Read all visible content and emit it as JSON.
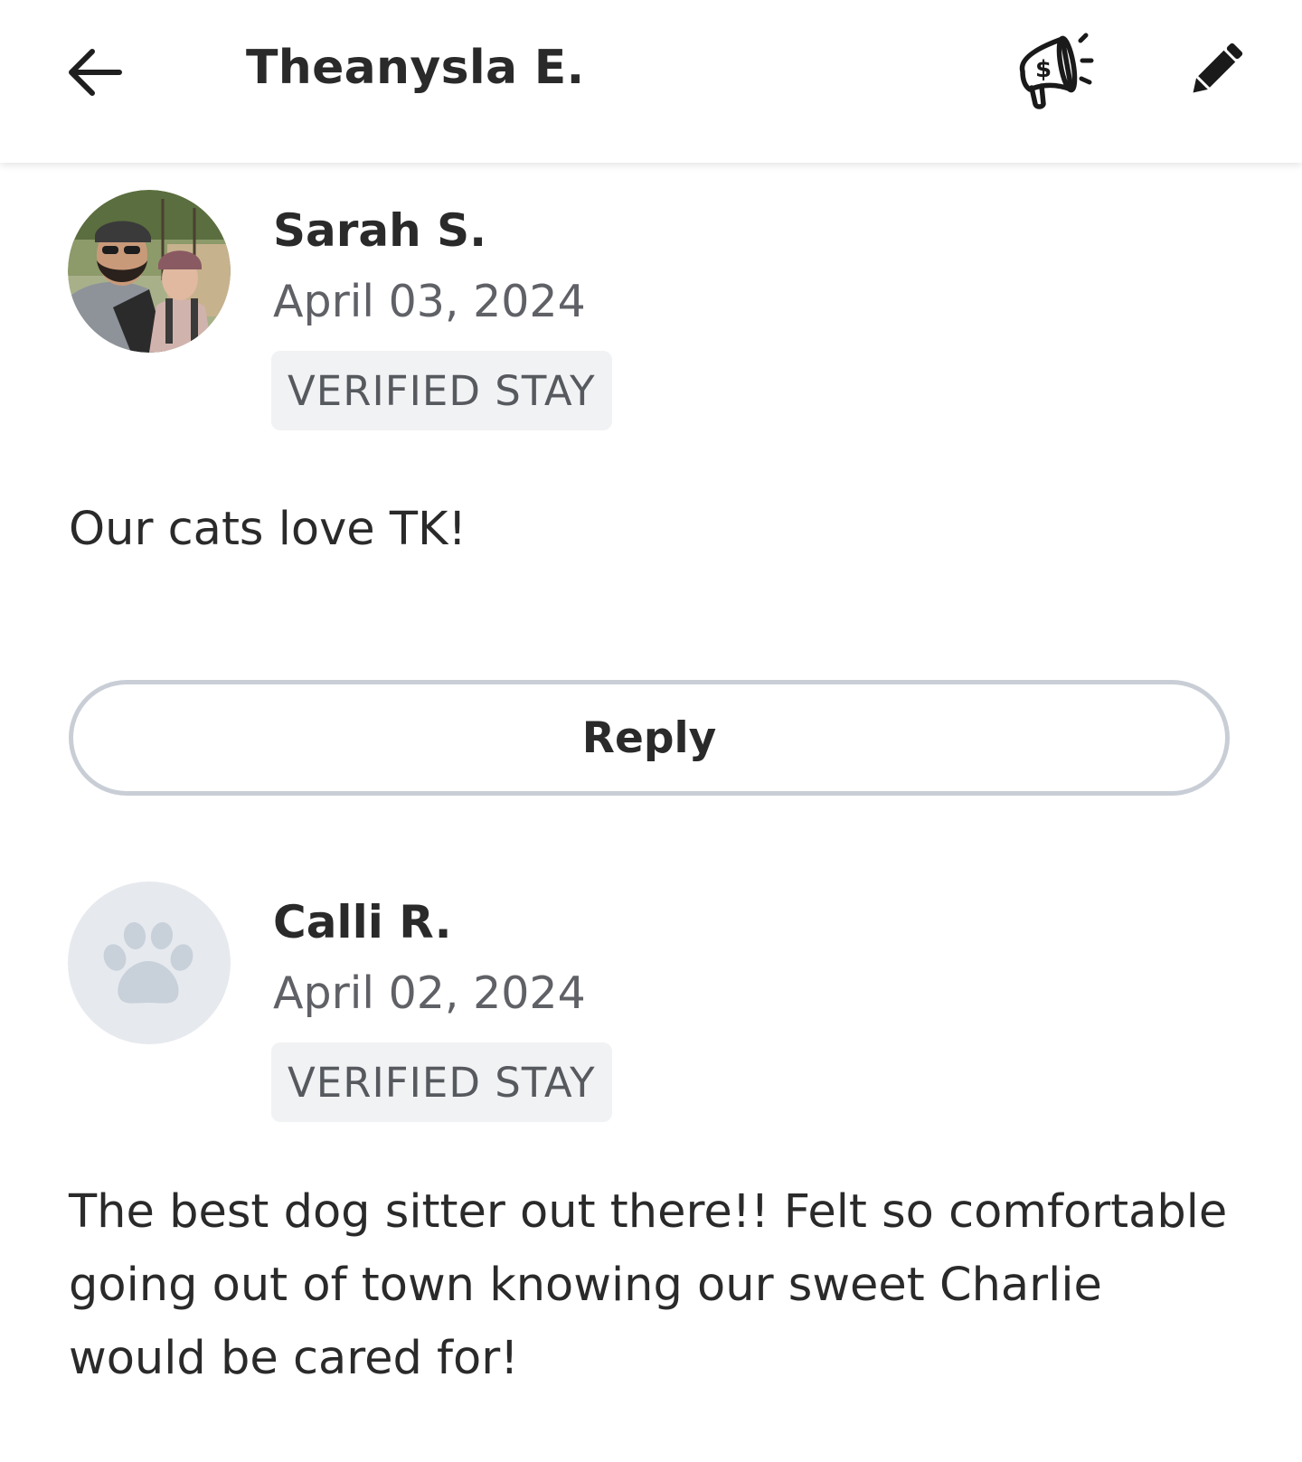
{
  "header": {
    "title": "Theanysla E.",
    "icons": {
      "back": "arrow-left-icon",
      "promo": "megaphone-dollar-icon",
      "edit": "pencil-icon"
    }
  },
  "reviews": [
    {
      "name": "Sarah S.",
      "date": "April 03, 2024",
      "badge": "VERIFIED STAY",
      "text": "Our cats love TK!",
      "avatar": "photo"
    },
    {
      "name": "Calli R.",
      "date": "April 02, 2024",
      "badge": "VERIFIED STAY",
      "text": "The best dog sitter out there!! Felt so comfortable going out of town knowing our sweet Charlie would be cared for!",
      "avatar": "paw-placeholder-icon"
    }
  ],
  "reply_button": {
    "label": "Reply"
  },
  "colors": {
    "badge_bg": "#f1f2f4",
    "reply_border": "#c9ced6",
    "paw": "#c8d0da",
    "paw_bg": "#e6e9ee"
  }
}
